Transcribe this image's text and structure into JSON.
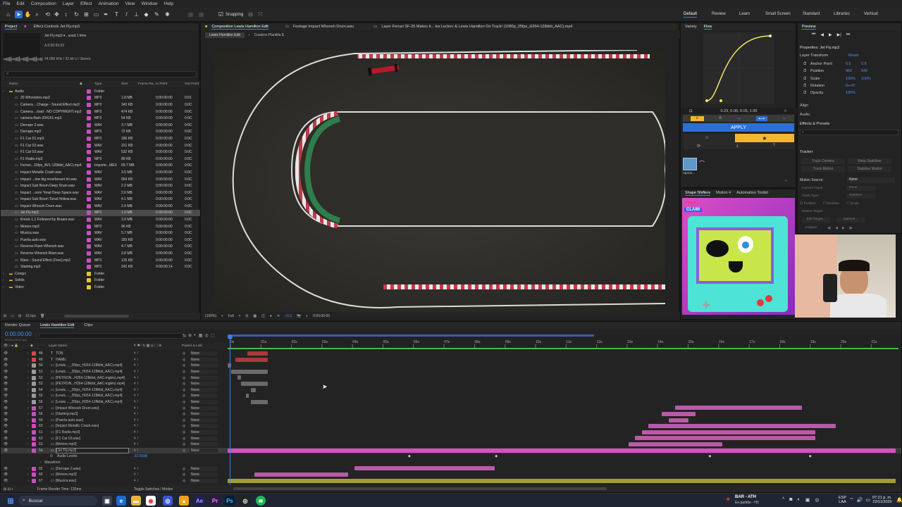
{
  "menu": [
    "File",
    "Edit",
    "Composition",
    "Layer",
    "Effect",
    "Animation",
    "View",
    "Window",
    "Help"
  ],
  "toolbar": {
    "snapping_label": "Snapping"
  },
  "workspaces": [
    "Default",
    "Review",
    "Learn",
    "Small Screen",
    "Standard",
    "Libraries",
    "Vertical"
  ],
  "project": {
    "tabs": [
      "Project",
      "Effect Controls Jet Fly.mp3"
    ],
    "selected_file": "Jet Fly.mp3 ▾ , used 1 time",
    "duration": "Δ 0:00:55:03",
    "audio_info": "24.000 kHz / 32 bit U / Stereo",
    "search_placeholder": "⌕",
    "columns": [
      "Name",
      "Type",
      "Size",
      "Frame Ra...",
      "In Point",
      "Out Point"
    ],
    "items": [
      {
        "name": "Audio",
        "type": "Folder",
        "size": "",
        "in": "",
        "out": "",
        "color": "#c84fbf",
        "folder": true,
        "depth": 0
      },
      {
        "name": "20 Whooshes.mp3",
        "type": "MP3",
        "size": "1.8 MB",
        "in": "0:00:00:00",
        "out": "0:01",
        "color": "#c84fbf",
        "depth": 1
      },
      {
        "name": "Camera ...Charge - Sound Effect.mp3",
        "type": "MP3",
        "size": "343 KB",
        "in": "0:00:00:00",
        "out": "0:0C",
        "color": "#c84fbf",
        "depth": 1
      },
      {
        "name": "Camera ...load - NO COPYRIGHT.mp3",
        "type": "MP3",
        "size": "474 KB",
        "in": "0:00:00:00",
        "out": "0:0C",
        "color": "#c84fbf",
        "depth": 1
      },
      {
        "name": "camera-flash-204151.mp3",
        "type": "MP3",
        "size": "54 KB",
        "in": "0:00:00:00",
        "out": "0:0C",
        "color": "#c84fbf",
        "depth": 1
      },
      {
        "name": "Derrape 2.wav",
        "type": "WAV",
        "size": "3.7 MB",
        "in": "0:00:00:00",
        "out": "0:0C",
        "color": "#c84fbf",
        "depth": 1
      },
      {
        "name": "Derrape.mp3",
        "type": "MP3",
        "size": "72 KB",
        "in": "0:00:00:00",
        "out": "0:0C",
        "color": "#c84fbf",
        "depth": 1
      },
      {
        "name": "F1 Car 01.mp3",
        "type": "MP3",
        "size": "186 KB",
        "in": "0:00:00:00",
        "out": "0:0C",
        "color": "#c84fbf",
        "depth": 1
      },
      {
        "name": "F1 Car 02.wav",
        "type": "WAV",
        "size": "221 KB",
        "in": "0:00:00:00",
        "out": "0:0C",
        "color": "#c84fbf",
        "depth": 1
      },
      {
        "name": "F1 Car 03.wav",
        "type": "WAV",
        "size": "532 KB",
        "in": "0:00:00:00",
        "out": "0:0C",
        "color": "#c84fbf",
        "depth": 1
      },
      {
        "name": "F1 Radio.mp3",
        "type": "MP3",
        "size": "89 KB",
        "in": "0:00:00:00",
        "out": "0:0C",
        "color": "#c84fbf",
        "depth": 1
      },
      {
        "name": "Ferrari...10fps_AV1-128kbit_AAC).mp4",
        "type": "Importe...MEX",
        "size": "69.7 MB",
        "in": "0:00:00:00",
        "out": "0:0C",
        "color": "#c84fbf",
        "depth": 1
      },
      {
        "name": "Impact Metallic Crash.wav",
        "type": "WAV",
        "size": "3.5 MB",
        "in": "0:00:00:00",
        "out": "0:0C",
        "color": "#c84fbf",
        "depth": 1
      },
      {
        "name": "Impact ...low big reverberant hit.wav",
        "type": "WAV",
        "size": "954 KB",
        "in": "0:00:00:00",
        "out": "0:0C",
        "color": "#c84fbf",
        "depth": 1
      },
      {
        "name": "Impact Sub Boom Deep Drum.wav",
        "type": "WAV",
        "size": "2.2 MB",
        "in": "0:00:00:00",
        "out": "0:0C",
        "color": "#c84fbf",
        "depth": 1
      },
      {
        "name": "Impact ...oom Tonal Deep Space.wav",
        "type": "WAV",
        "size": "2.6 MB",
        "in": "0:00:00:00",
        "out": "0:0C",
        "color": "#c84fbf",
        "depth": 1
      },
      {
        "name": "Impact Sub Boom Tonal Hollow.wav",
        "type": "WAV",
        "size": "4.1 MB",
        "in": "0:00:00:00",
        "out": "0:0C",
        "color": "#c84fbf",
        "depth": 1
      },
      {
        "name": "Impact Whoosh Drum.wav",
        "type": "WAV",
        "size": "2.4 MB",
        "in": "0:00:00:00",
        "out": "0:0C",
        "color": "#c84fbf",
        "depth": 1
      },
      {
        "name": "Jet Fly.mp3",
        "type": "MP3",
        "size": "1.0 MB",
        "in": "0:00:00:00",
        "out": "0:0C",
        "color": "#c84fbf",
        "depth": 1,
        "selected": true
      },
      {
        "name": "Knock 1,1 Followed by Braam.wav",
        "type": "WAV",
        "size": "3.0 MB",
        "in": "0:00:00:00",
        "out": "0:0C",
        "color": "#c84fbf",
        "depth": 1
      },
      {
        "name": "Motore.mp3",
        "type": "MP3",
        "size": "96 KB",
        "in": "0:00:00:00",
        "out": "0:0C",
        "color": "#c84fbf",
        "depth": 1
      },
      {
        "name": "Musica.wav",
        "type": "WAV",
        "size": "5.7 MB",
        "in": "0:00:00:00",
        "out": "0:0C",
        "color": "#c84fbf",
        "depth": 1
      },
      {
        "name": "Puerta auto.wav",
        "type": "WAV",
        "size": "183 KB",
        "in": "0:00:00:00",
        "out": "0:0C",
        "color": "#c84fbf",
        "depth": 1
      },
      {
        "name": "Reverse Riser Whoosh.wav",
        "type": "WAV",
        "size": "4.7 MB",
        "in": "0:00:00:00",
        "out": "0:0C",
        "color": "#c84fbf",
        "depth": 1
      },
      {
        "name": "Reverse Whoosh Riser.wav",
        "type": "WAV",
        "size": "3.8 MB",
        "in": "0:00:00:00",
        "out": "0:0C",
        "color": "#c84fbf",
        "depth": 1
      },
      {
        "name": "Riser - Sound Effect (Free).mp3",
        "type": "MP3",
        "size": "125 KB",
        "in": "0:00:00:00",
        "out": "0:0C",
        "color": "#c84fbf",
        "depth": 1
      },
      {
        "name": "Starting.mp3",
        "type": "MP3",
        "size": "242 KB",
        "in": "0:00:00:14",
        "out": "0:0C",
        "color": "#c84fbf",
        "depth": 1
      },
      {
        "name": "Comps",
        "type": "Folder",
        "size": "",
        "in": "",
        "out": "",
        "color": "#e0c53a",
        "folder": true,
        "depth": 0
      },
      {
        "name": "Solids",
        "type": "Folder",
        "size": "",
        "in": "",
        "out": "",
        "color": "#e0c53a",
        "folder": true,
        "depth": 0
      },
      {
        "name": "Video",
        "type": "Folder",
        "size": "",
        "in": "",
        "out": "",
        "color": "#e0c53a",
        "folder": true,
        "depth": 0
      }
    ],
    "footer_bpc": "16 bpc"
  },
  "viewer": {
    "tabs": [
      "Composition Lewis Hamilton Edit",
      "Footage Impact Whoosh Drum.wav",
      "Layer Ferrari SF-25 Makes it... les Leclerc & Lewis Hamilton On Track! (1080p_25fps_H264-128kbit_AAC).mp4"
    ],
    "subtabs": [
      "Lewis Hamilton Edit",
      "Cuadros Plantilla $"
    ],
    "zoom": "(100%)",
    "resolution": "Full",
    "exposure": "+0.0",
    "time": "0:00:00:00"
  },
  "flow": {
    "tabs": [
      "Variety",
      "Flow"
    ],
    "curve_values": "0.23, 0.00, 0.03, 1.00",
    "apply_label": "APPLY",
    "preset_label": "rapido..."
  },
  "preview": {
    "title": "Preview"
  },
  "properties": {
    "title": "Properties: Jet Fly.mp3",
    "section": "Layer Transform",
    "reset": "Reset",
    "rows": [
      {
        "label": "Anchor Point",
        "values": [
          "0.5",
          "0.5"
        ]
      },
      {
        "label": "Position",
        "values": [
          "960",
          "540"
        ]
      },
      {
        "label": "Scale",
        "values": [
          "100%",
          "100%"
        ]
      },
      {
        "label": "Rotation",
        "values": [
          "0x+0°"
        ]
      },
      {
        "label": "Opacity",
        "values": [
          "100%"
        ]
      }
    ],
    "align": "Align",
    "audio": "Audio",
    "effects": "Effects & Presets",
    "effects_search": "⌕"
  },
  "tracker": {
    "title": "Tracker",
    "buttons": [
      "Track Camera",
      "Warp Stabilizer",
      "Track Motion",
      "Stabilize Motion"
    ],
    "motion_source_label": "Motion Source:",
    "motion_source_value": "None",
    "current_track_label": "Current Track:",
    "current_track_value": "None",
    "track_type_label": "Track Type:",
    "track_type_value": "Stabilize",
    "options": [
      "Position",
      "Rotation",
      "Scale"
    ],
    "motion_target": "Motion Target:",
    "edit_target": "Edit Target...",
    "options_btn": "Options...",
    "analyze": "Analyze:"
  },
  "shape_panel": {
    "tabs": [
      "Shape Shifters",
      "Motion 4",
      "Automation Toolkit"
    ],
    "claim_label": "CLAIM"
  },
  "timeline": {
    "tabs": [
      "Render Queue",
      "Lewis Hamilton Edit",
      "Clips"
    ],
    "current_time": "0:00:00:00",
    "fps_note": "00000 (25.00 fps)",
    "columns": {
      "layer_name": "Layer Name",
      "parent": "Parent & Link"
    },
    "ruler": [
      "0s",
      "01s",
      "02s",
      "03s",
      "04s",
      "05s",
      "06s",
      "07s",
      "08s",
      "09s",
      "10s",
      "11s",
      "12s",
      "13s",
      "14s",
      "15s",
      "16s",
      "17s",
      "18s",
      "19s",
      "20s",
      "21s"
    ],
    "layers": [
      {
        "num": "48",
        "name": "TON",
        "type": "T",
        "color": "#d24a4a",
        "parent": "None",
        "bar_start": 0.03,
        "bar_end": 0.06,
        "bar_color": "#a83a3a"
      },
      {
        "num": "49",
        "name": "HAMIL",
        "type": "T",
        "color": "#d24a4a",
        "parent": "None",
        "bar_start": 0.012,
        "bar_end": 0.06,
        "bar_color": "#a83a3a"
      },
      {
        "num": "50",
        "name": "[Lewis ..._25fps_H264-128kbit_AAC).mp4]",
        "type": "",
        "color": "#9b9b9b",
        "parent": "None",
        "bar_start": 0.0,
        "bar_end": 0.005,
        "bar_color": "#6a6a6a"
      },
      {
        "num": "51",
        "name": "[Lewis ..._25fps_H264-128kbit_AAC).mp4]",
        "type": "",
        "color": "#9b9b9b",
        "parent": "None",
        "bar_start": 0.005,
        "bar_end": 0.06,
        "bar_color": "#6a6a6a"
      },
      {
        "num": "52",
        "name": "[PETRON...H264-128kbit_AAC-inglés).mp4]",
        "type": "",
        "color": "#9b9b9b",
        "parent": "None",
        "bar_start": 0.015,
        "bar_end": 0.02,
        "bar_color": "#6a6a6a"
      },
      {
        "num": "53",
        "name": "[PETRON...H264-128kbit_AAC-inglés).mp4]",
        "type": "",
        "color": "#9b9b9b",
        "parent": "None",
        "bar_start": 0.02,
        "bar_end": 0.06,
        "bar_color": "#6a6a6a"
      },
      {
        "num": "54",
        "name": "[Lewis ..._25fps_H264-128kbit_AAC).mp4]",
        "type": "",
        "color": "#9b9b9b",
        "parent": "None",
        "bar_start": 0.035,
        "bar_end": 0.042,
        "bar_color": "#6a6a6a"
      },
      {
        "num": "55",
        "name": "[Lewis ..._25fps_H264-128kbit_AAC).mp4]",
        "type": "",
        "color": "#9b9b9b",
        "parent": "None",
        "bar_start": 0.027,
        "bar_end": 0.032,
        "bar_color": "#6a6a6a"
      },
      {
        "num": "56",
        "name": "[Lewis ..._25fps_H264-128kbit_AAC).mp4]",
        "type": "",
        "color": "#9b9b9b",
        "parent": "None",
        "bar_start": 0.035,
        "bar_end": 0.06,
        "bar_color": "#6a6a6a"
      },
      {
        "num": "57",
        "name": "[Impact Whoosh Drum.wav]",
        "type": "",
        "color": "#c84fbf",
        "parent": "None",
        "bar_start": 0.67,
        "bar_end": 0.86,
        "bar_color": "#b85aa8"
      },
      {
        "num": "58",
        "name": "[Starting.mp3]",
        "type": "",
        "color": "#c84fbf",
        "parent": "None",
        "bar_start": 0.65,
        "bar_end": 0.7,
        "bar_color": "#b85aa8"
      },
      {
        "num": "59",
        "name": "[Puerta auto.wav]",
        "type": "",
        "color": "#c84fbf",
        "parent": "None",
        "bar_start": 0.66,
        "bar_end": 0.69,
        "bar_color": "#b85aa8"
      },
      {
        "num": "60",
        "name": "[Impact Metallic Crash.wav]",
        "type": "",
        "color": "#c84fbf",
        "parent": "None",
        "bar_start": 0.63,
        "bar_end": 0.91,
        "bar_color": "#b85aa8"
      },
      {
        "num": "61",
        "name": "[F1 Radio.mp3]",
        "type": "",
        "color": "#c84fbf",
        "parent": "None",
        "bar_start": 0.62,
        "bar_end": 0.88,
        "bar_color": "#b85aa8"
      },
      {
        "num": "62",
        "name": "[F1 Car 03.wav]",
        "type": "",
        "color": "#c84fbf",
        "parent": "None",
        "bar_start": 0.61,
        "bar_end": 0.88,
        "bar_color": "#b85aa8"
      },
      {
        "num": "63",
        "name": "[Motore.mp3]",
        "type": "",
        "color": "#c84fbf",
        "parent": "None",
        "bar_start": 0.6,
        "bar_end": 0.74,
        "bar_color": "#b85aa8"
      },
      {
        "num": "64",
        "name": "[Jet Fly.mp3]",
        "type": "",
        "color": "#c84fbf",
        "parent": "None",
        "bar_start": 0.0,
        "bar_end": 1.0,
        "bar_color": "#d94ec6",
        "selected": true
      }
    ],
    "sublayer_levels_label": "Audio Levels",
    "sublayer_levels_value": "-32.00dB",
    "sublayer_waveform": "Waveform",
    "extra_layers": [
      {
        "num": "65",
        "name": "[Derrape 2.wav]",
        "color": "#c84fbf",
        "parent": "None",
        "bar_start": 0.19,
        "bar_end": 0.4,
        "bar_color": "#b85aa8"
      },
      {
        "num": "66",
        "name": "[Motore.mp3]",
        "color": "#c84fbf",
        "parent": "None",
        "bar_start": 0.04,
        "bar_end": 0.18,
        "bar_color": "#b85aa8"
      },
      {
        "num": "67",
        "name": "[Musica.wav]",
        "color": "#c84fbf",
        "parent": "None",
        "bar_start": 0.0,
        "bar_end": 1.0,
        "bar_color": "#a39c3a"
      }
    ],
    "footer_render": "Frame Render Time: 133ms",
    "footer_toggle": "Toggle Switches / Modes"
  },
  "taskbar": {
    "search": "Buscar",
    "notify_title": "BAR - ATH",
    "notify_sub": "En partido - H2",
    "lang": "ESP",
    "lang2": "LAA",
    "time": "07:21 p. m.",
    "date": "22/11/2025"
  }
}
